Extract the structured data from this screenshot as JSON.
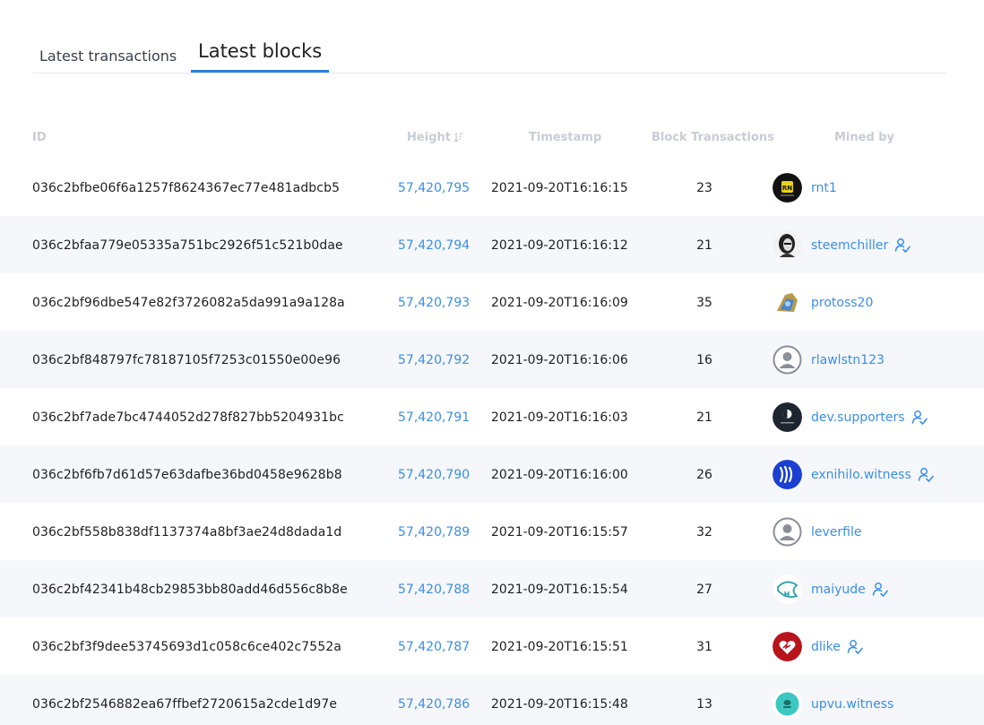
{
  "tabs": [
    {
      "label": "Latest transactions",
      "active": false
    },
    {
      "label": "Latest blocks",
      "active": true
    }
  ],
  "columns": {
    "id": "ID",
    "height": "Height",
    "timestamp": "Timestamp",
    "block_transactions": "Block Transactions",
    "mined_by": "Mined by"
  },
  "colors": {
    "accent": "#2a7fe0",
    "link": "#3b8ee8",
    "header_text": "#c8ccd3",
    "stripe": "#f5f7fa"
  },
  "blocks": [
    {
      "id": "036c2bfbe06f6a1257f8624367ec77e481adbcb5",
      "height": "57,420,795",
      "timestamp": "2021-09-20T16:16:15",
      "transactions": "23",
      "miner": "rnt1",
      "avatar": "rnt1-avatar",
      "verified": false
    },
    {
      "id": "036c2bfaa779e05335a751bc2926f51c521b0dae",
      "height": "57,420,794",
      "timestamp": "2021-09-20T16:16:12",
      "transactions": "21",
      "miner": "steemchiller",
      "avatar": "steemchiller-avatar",
      "verified": true
    },
    {
      "id": "036c2bf96dbe547e82f3726082a5da991a9a128a",
      "height": "57,420,793",
      "timestamp": "2021-09-20T16:16:09",
      "transactions": "35",
      "miner": "protoss20",
      "avatar": "protoss20-avatar",
      "verified": false
    },
    {
      "id": "036c2bf848797fc78187105f7253c01550e00e96",
      "height": "57,420,792",
      "timestamp": "2021-09-20T16:16:06",
      "transactions": "16",
      "miner": "rlawlstn123",
      "avatar": "default-user-avatar",
      "verified": false
    },
    {
      "id": "036c2bf7ade7bc4744052d278f827bb5204931bc",
      "height": "57,420,791",
      "timestamp": "2021-09-20T16:16:03",
      "transactions": "21",
      "miner": "dev.supporters",
      "avatar": "dev-supporters-avatar",
      "verified": true
    },
    {
      "id": "036c2bf6fb7d61d57e63dafbe36bd0458e9628b8",
      "height": "57,420,790",
      "timestamp": "2021-09-20T16:16:00",
      "transactions": "26",
      "miner": "exnihilo.witness",
      "avatar": "steem-logo-avatar",
      "verified": true
    },
    {
      "id": "036c2bf558b838df1137374a8bf3ae24d8dada1d",
      "height": "57,420,789",
      "timestamp": "2021-09-20T16:15:57",
      "transactions": "32",
      "miner": "leverfile",
      "avatar": "default-user-avatar",
      "verified": false
    },
    {
      "id": "036c2bf42341b48cb29853bb80add46d556c8b8e",
      "height": "57,420,788",
      "timestamp": "2021-09-20T16:15:54",
      "transactions": "27",
      "miner": "maiyude",
      "avatar": "maiyude-fish-avatar",
      "verified": true
    },
    {
      "id": "036c2bf3f9dee53745693d1c058c6ce402c7552a",
      "height": "57,420,787",
      "timestamp": "2021-09-20T16:15:51",
      "transactions": "31",
      "miner": "dlike",
      "avatar": "dlike-heart-avatar",
      "verified": true
    },
    {
      "id": "036c2bf2546882ea67ffbef2720615a2cde1d97e",
      "height": "57,420,786",
      "timestamp": "2021-09-20T16:15:48",
      "transactions": "13",
      "miner": "upvu.witness",
      "avatar": "upvu-avatar",
      "verified": false
    }
  ]
}
